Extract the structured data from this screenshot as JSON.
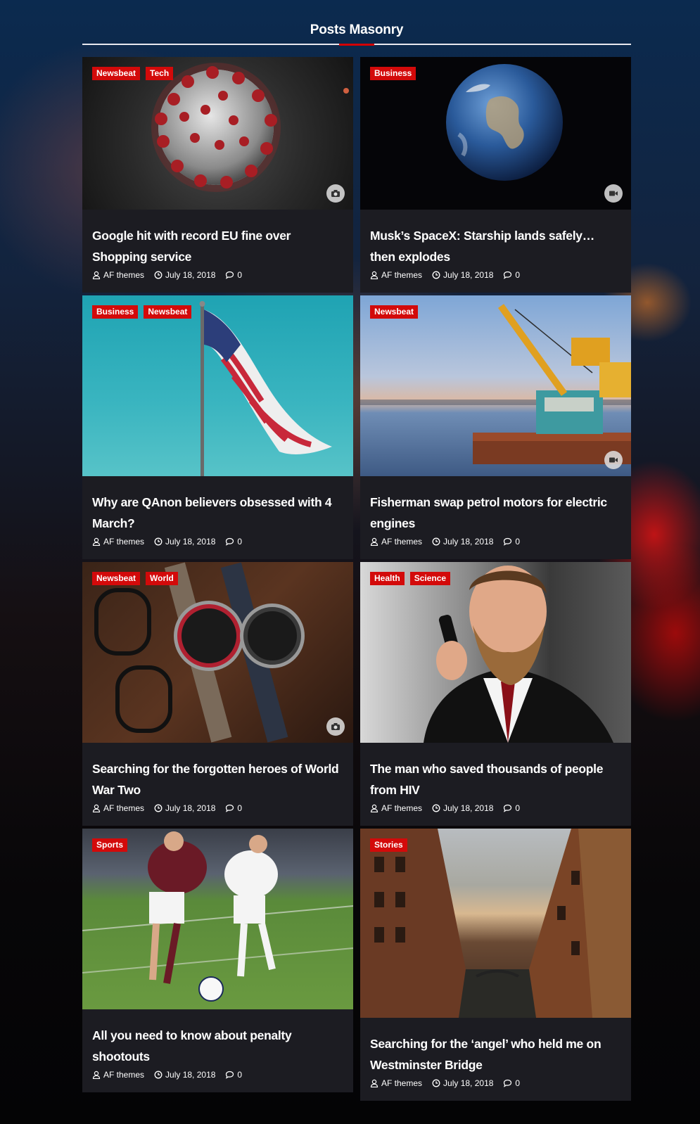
{
  "section": {
    "title": "Posts Masonry"
  },
  "meta_icons": {
    "author": "user-icon",
    "date": "clock-icon",
    "comments": "comment-icon"
  },
  "posts": [
    {
      "categories": [
        "Newsbeat",
        "Tech"
      ],
      "title": "Google hit with record EU fine over Shopping service",
      "author": "AF themes",
      "date": "July 18, 2018",
      "comments": "0",
      "format": "camera-icon",
      "image": "coronavirus-render"
    },
    {
      "categories": [
        "Business"
      ],
      "title": "Musk’s SpaceX: Starship lands safely… then explodes",
      "author": "AF themes",
      "date": "July 18, 2018",
      "comments": "0",
      "format": "video-icon",
      "image": "earth-from-space"
    },
    {
      "categories": [
        "Business",
        "Newsbeat"
      ],
      "title": "Why are QAnon believers obsessed with 4 March?",
      "author": "AF themes",
      "date": "July 18, 2018",
      "comments": "0",
      "format": "",
      "image": "american-flag"
    },
    {
      "categories": [
        "Newsbeat"
      ],
      "title": "Fisherman swap petrol motors for electric engines",
      "author": "AF themes",
      "date": "July 18, 2018",
      "comments": "0",
      "format": "video-icon",
      "image": "crane-barge"
    },
    {
      "categories": [
        "Newsbeat",
        "World"
      ],
      "title": "Searching for the forgotten heroes of World War Two",
      "author": "AF themes",
      "date": "July 18, 2018",
      "comments": "0",
      "format": "camera-icon",
      "image": "watches-glasses"
    },
    {
      "categories": [
        "Health",
        "Science"
      ],
      "title": "The man who saved thousands of people from HIV",
      "author": "AF themes",
      "date": "July 18, 2018",
      "comments": "0",
      "format": "",
      "image": "bearded-man-phone"
    },
    {
      "categories": [
        "Sports"
      ],
      "title": "All you need to know about penalty shootouts",
      "author": "AF themes",
      "date": "July 18, 2018",
      "comments": "0",
      "format": "",
      "image": "soccer-players"
    },
    {
      "categories": [
        "Stories"
      ],
      "title": "Searching for the ‘angel’ who held me on Westminster Bridge",
      "author": "AF themes",
      "date": "July 18, 2018",
      "comments": "0",
      "format": "",
      "image": "canal-buildings"
    }
  ]
}
